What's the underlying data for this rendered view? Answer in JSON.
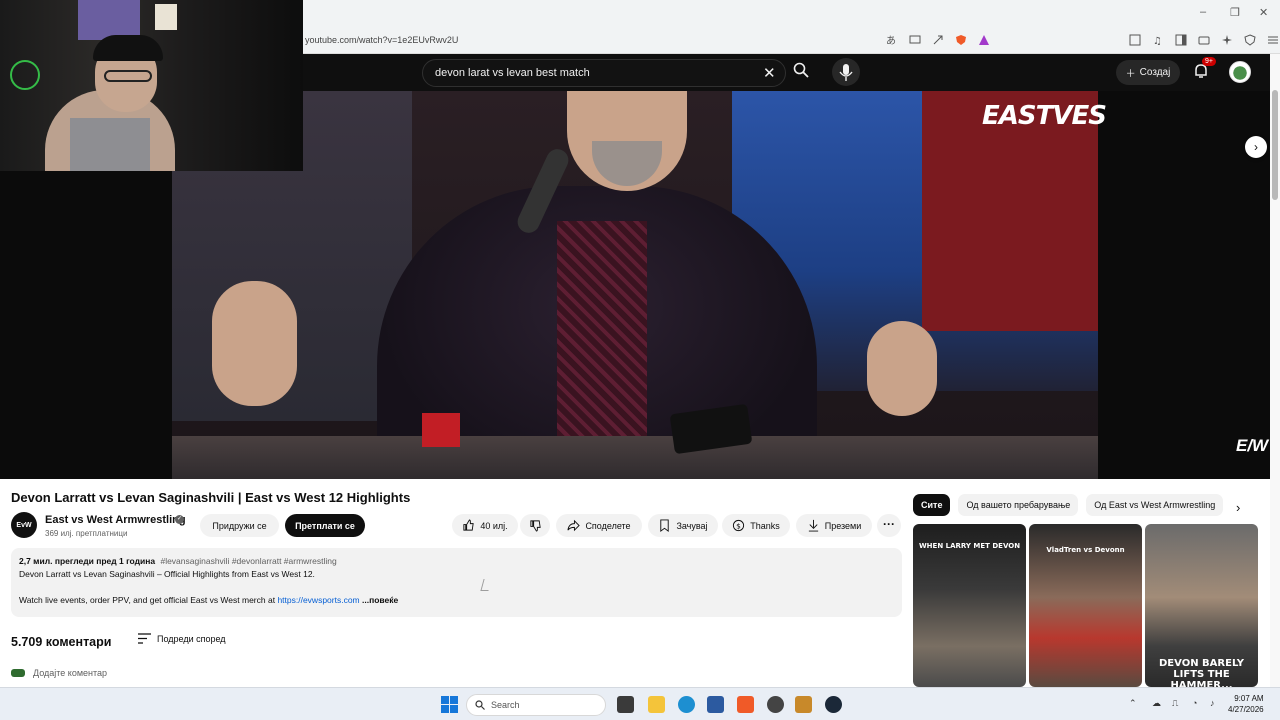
{
  "browser": {
    "url": "youtube.com/watch?v=1e2EUvRwv2U",
    "window_controls": [
      "–",
      "❐",
      "✕"
    ]
  },
  "header": {
    "search_query": "devon larat vs levan best match",
    "create_label": "Создај",
    "notifications_badge": "9+"
  },
  "video": {
    "watermark": "E/W",
    "shirt_text": "EASTVES"
  },
  "details": {
    "title": "Devon Larratt vs Levan Saginashvili | East vs West 12 Highlights",
    "channel_name": "East vs West Armwrestling",
    "channel_avatar_text": "EvW",
    "subscribers": "369 илј. претплатници",
    "join_label": "Придружи се",
    "subscribe_label": "Претплати се",
    "likes": "40 илј.",
    "share_label": "Споделете",
    "save_label": "Зачувај",
    "thanks_label": "Thanks",
    "download_label": "Преземи",
    "more_label": "···"
  },
  "description": {
    "meta": "2,7 мил. прегледи  пред 1 година",
    "tags": "#levansaginashvili #devonlarratt #armwrestling",
    "line1": "Devon Larratt vs Levan Saginashvili – Official Highlights from East vs West 12.",
    "line2": "Watch live events, order PPV, and get official East vs West merch at",
    "link": "https://evwsports.com",
    "more": " ...повеќе"
  },
  "comments": {
    "count": "5.709 коментари",
    "sort_label": "Подреди според",
    "add_placeholder": "Додајте коментар"
  },
  "sidebar": {
    "chips": [
      "Сите",
      "Од вашето пребарување",
      "Од East vs West Armwrestling"
    ],
    "thumbnails": [
      {
        "caption": "WHEN LARRY MET DEVON"
      },
      {
        "caption": "VladTren vs Devonn"
      },
      {
        "caption": "DEVON BARELY LIFTS THE HAMMER..."
      }
    ]
  },
  "taskbar": {
    "search_label": "Search",
    "time": "9:07 AM",
    "date": "4/27/2026"
  },
  "colors": {
    "accent_link": "#065fd4",
    "subscribe_bg": "#0f0f0f",
    "badge_red": "#cc0000"
  }
}
